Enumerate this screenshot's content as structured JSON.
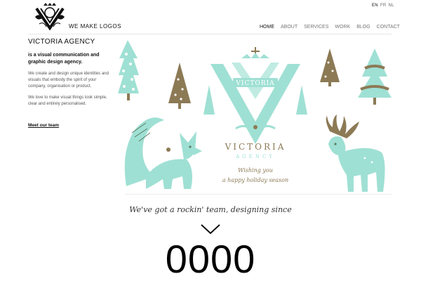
{
  "colors": {
    "mint": "#9fe0d4",
    "brown": "#8c7a55",
    "text": "#222222"
  },
  "lang": {
    "items": [
      "EN",
      "FR",
      "NL"
    ],
    "active": "EN"
  },
  "logo": {
    "text": "WE MAKE  LOGOS",
    "icon": "crest-icon"
  },
  "nav": {
    "items": [
      "HOME",
      "ABOUT",
      "SERVICES",
      "WORK",
      "BLOG",
      "CONTACT"
    ],
    "active": "HOME"
  },
  "sidebar": {
    "title": "VICTORIA AGENCY",
    "tagline": "is a visual communication and graphic design agency.",
    "para1": "We create and design unique identities and visuals that embody the spirit of your company, organisation or product.",
    "para2": "We love to make visual things look simple, clear and entirely personalised.",
    "link": "Meet our team"
  },
  "hero": {
    "banner": "VICTORIA",
    "brand": "VICTORIA",
    "brand_sub": "AGENCY",
    "greeting_line1": "Wishing you",
    "greeting_line2": "a happy holiday season"
  },
  "team": {
    "tagline": "We've got a rockin' team, designing since",
    "counter": "0000",
    "icon": "chevron-down-icon"
  }
}
